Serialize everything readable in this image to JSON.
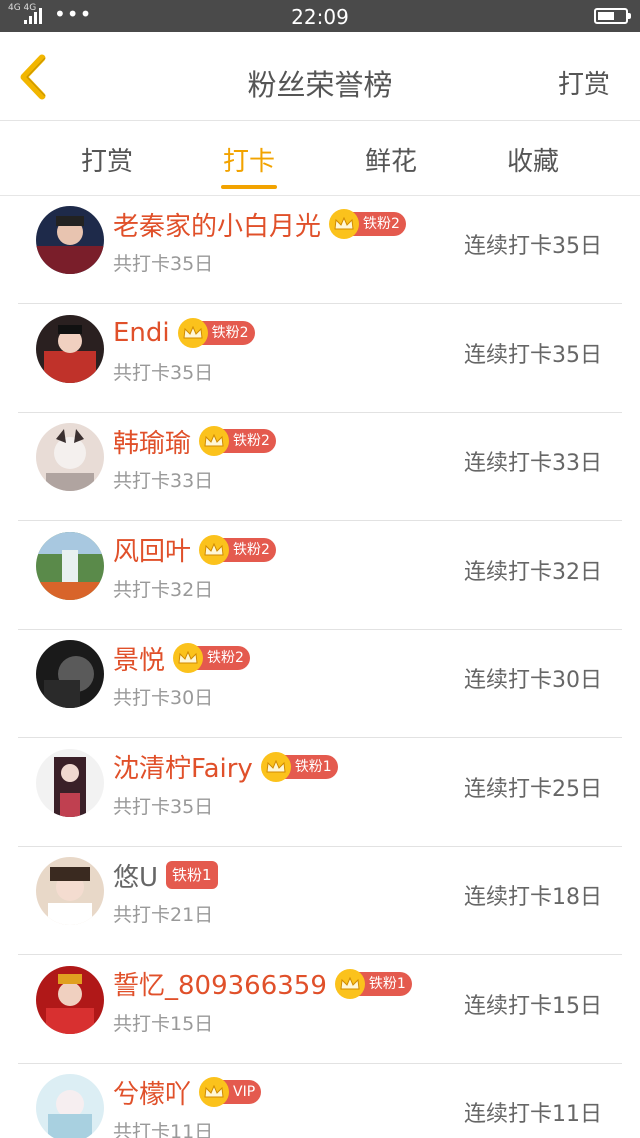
{
  "status_bar": {
    "network": "4G 4G",
    "time": "22:09"
  },
  "nav": {
    "title": "粉丝荣誉榜",
    "right_action": "打赏"
  },
  "tabs": [
    {
      "label": "打赏",
      "active": false
    },
    {
      "label": "打卡",
      "active": true
    },
    {
      "label": "鲜花",
      "active": false
    },
    {
      "label": "收藏",
      "active": false
    }
  ],
  "colors": {
    "accent": "#f2a300",
    "name": "#e0502a",
    "badge": "#e45a4e",
    "crown": "#fbc21c"
  },
  "fans": [
    {
      "name": "老秦家的小白月光",
      "badge": "铁粉2",
      "crown": true,
      "total": "共打卡35日",
      "streak": "连续打卡35日"
    },
    {
      "name": "Endi",
      "badge": "铁粉2",
      "crown": true,
      "total": "共打卡35日",
      "streak": "连续打卡35日"
    },
    {
      "name": "韩瑜瑜",
      "badge": "铁粉2",
      "crown": true,
      "total": "共打卡33日",
      "streak": "连续打卡33日"
    },
    {
      "name": "风回叶",
      "badge": "铁粉2",
      "crown": true,
      "total": "共打卡32日",
      "streak": "连续打卡32日"
    },
    {
      "name": "景悦",
      "badge": "铁粉2",
      "crown": true,
      "total": "共打卡30日",
      "streak": "连续打卡30日"
    },
    {
      "name": "沈清柠Fairy",
      "badge": "铁粉1",
      "crown": true,
      "total": "共打卡35日",
      "streak": "连续打卡25日"
    },
    {
      "name": "悠U",
      "badge": "铁粉1",
      "crown": false,
      "total": "共打卡21日",
      "streak": "连续打卡18日"
    },
    {
      "name": "誓忆_809366359",
      "badge": "铁粉1",
      "crown": true,
      "total": "共打卡15日",
      "streak": "连续打卡15日"
    },
    {
      "name": "兮檬吖",
      "badge": "VIP",
      "crown": true,
      "total": "共打卡11日",
      "streak": "连续打卡11日"
    }
  ]
}
